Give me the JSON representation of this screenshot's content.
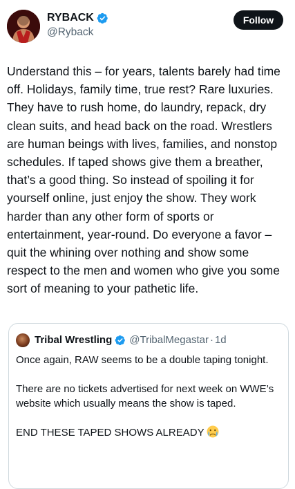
{
  "author": {
    "display_name": "RYBACK",
    "handle": "@Ryback",
    "verified": true,
    "avatar": "avatar-wrestler"
  },
  "follow_button": {
    "label": "Follow"
  },
  "tweet": {
    "text": "Understand this – for years, talents barely had time off. Holidays, family time, true rest? Rare luxuries. They have to rush home, do laundry, repack, dry clean suits, and head back on the road. Wrestlers are human beings with lives, families, and nonstop schedules. If taped shows give them a breather, that’s a good thing. So instead of spoiling it for yourself online, just enjoy the show. They work harder than any other form of sports or entertainment, year-round. Do everyone a favor – quit the whining over nothing and show some respect to the men and women who give you some sort of meaning to your pathetic life."
  },
  "quoted_tweet": {
    "display_name": "Tribal Wrestling",
    "handle": "@TribalMegastar",
    "separator": "·",
    "time": "1d",
    "verified": true,
    "paragraphs": [
      "Once again, RAW seems to be a double taping tonight.",
      "There are no tickets advertised for next week on WWE’s website which usually means the show is taped.",
      "END THESE TAPED SHOWS ALREADY"
    ],
    "emoji": "crying-face-emoji"
  },
  "colors": {
    "text_primary": "#0f1419",
    "text_secondary": "#536471",
    "verified_blue": "#1d9bf0",
    "border": "#cfd9de",
    "follow_bg": "#0f1419"
  }
}
